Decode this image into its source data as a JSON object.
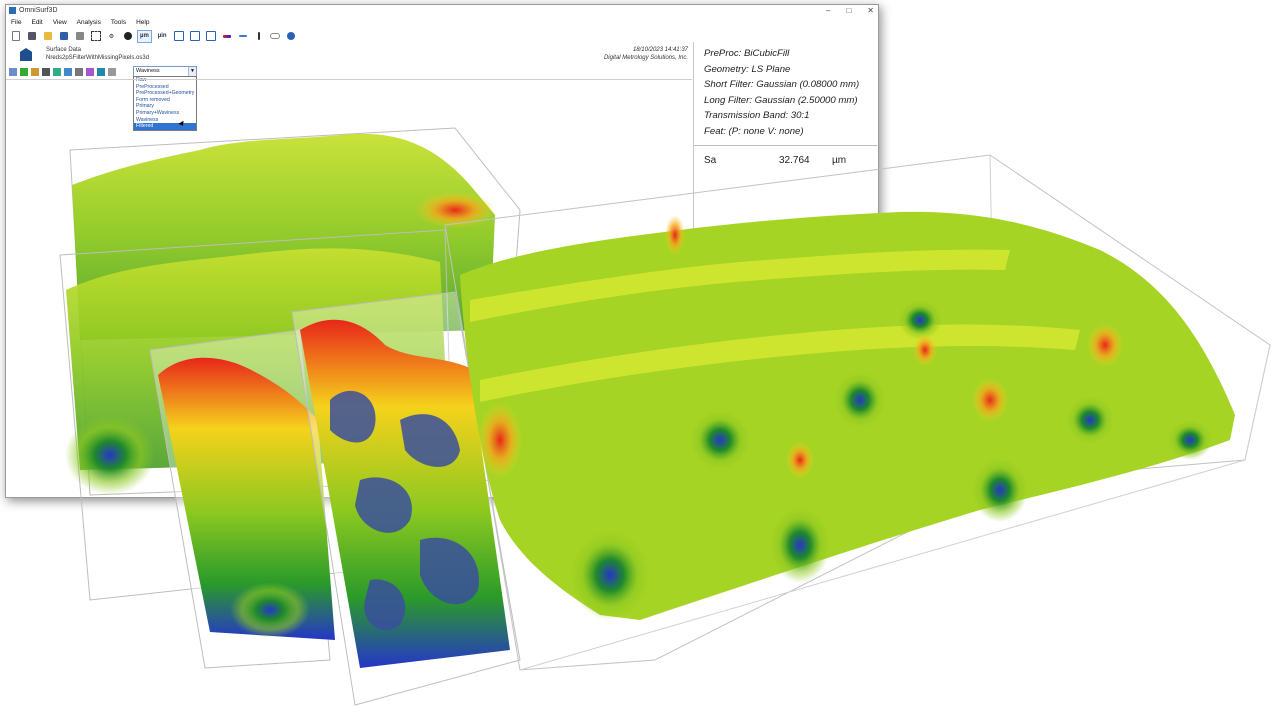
{
  "window": {
    "title": "OmniSurf3D",
    "controls": [
      "–",
      "□",
      "✕"
    ]
  },
  "menu": [
    "File",
    "Edit",
    "View",
    "Analysis",
    "Tools",
    "Help"
  ],
  "toolbar": {
    "units_um": "µm",
    "units_uin": "µin"
  },
  "header": {
    "surface_label": "Surface Data",
    "file_name": "Nreds2pSFilterWithMissingPixels.os3d",
    "date": "18/10/2023  14:41:37",
    "company": "Digital Metrology Solutions, Inc."
  },
  "view_select": {
    "selected": "Waviness",
    "options": [
      "Raw",
      "PreProcessed",
      "PreProcessed+Geometry",
      "Form removed",
      "Primary",
      "Primary+Waviness",
      "Waviness",
      "Filtered"
    ],
    "highlighted": "Filtered"
  },
  "panel": {
    "params": [
      "PreProc: BiCubicFill",
      "Geometry: LS Plane",
      "Short Filter: Gaussian (0.08000 mm)",
      "Long Filter: Gaussian (2.50000 mm)",
      "Transmission Band: 30:1",
      "Feat: (P: none    V: none)"
    ],
    "result": {
      "name": "Sa",
      "value": "32.764",
      "unit": "µm"
    }
  },
  "colors": {
    "peak": "#e8261a",
    "high": "#f5d21c",
    "mid": "#8cc820",
    "low": "#2a9a2a",
    "valley": "#2636c8"
  }
}
